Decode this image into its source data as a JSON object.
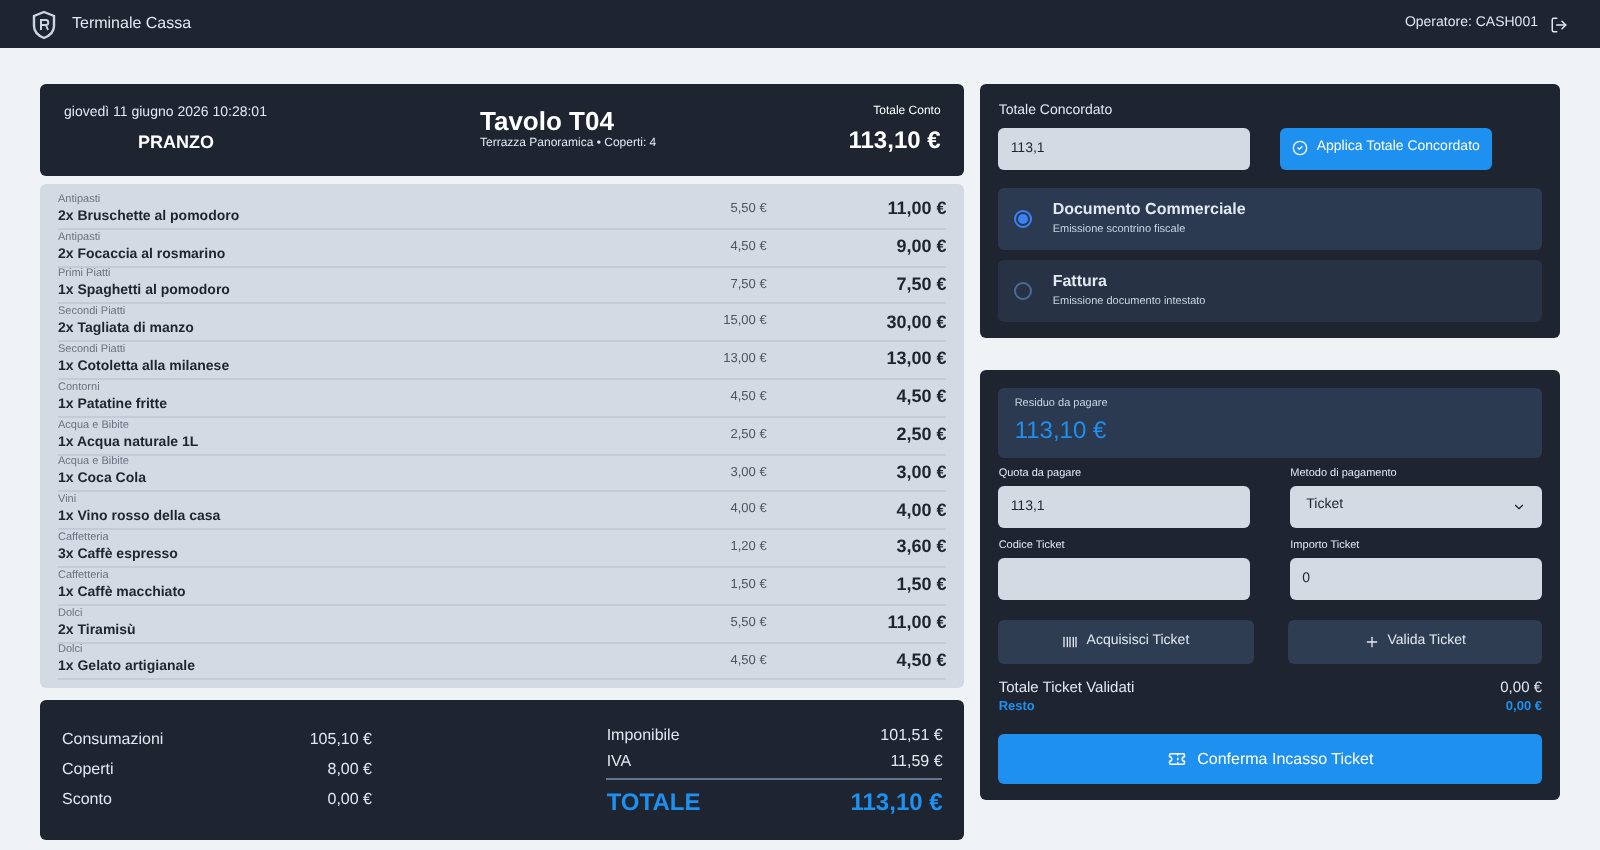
{
  "topbar": {
    "title": "Terminale Cassa",
    "operator": "Operatore: CASH001"
  },
  "order_header": {
    "datetime": "giovedì 11 giugno 2026 10:28:01",
    "service": "PRANZO",
    "table": "Tavolo T04",
    "location": "Terrazza Panoramica • Coperti: 4",
    "total_label": "Totale Conto",
    "total": "113,10 €"
  },
  "items": [
    {
      "category": "Antipasti",
      "name": "2x Bruschette al pomodoro",
      "unit_price": "5,50 €",
      "total": "11,00 €"
    },
    {
      "category": "Antipasti",
      "name": "2x Focaccia al rosmarino",
      "unit_price": "4,50 €",
      "total": "9,00 €"
    },
    {
      "category": "Primi Piatti",
      "name": "1x Spaghetti al pomodoro",
      "unit_price": "7,50 €",
      "total": "7,50 €"
    },
    {
      "category": "Secondi Piatti",
      "name": "2x Tagliata di manzo",
      "unit_price": "15,00 €",
      "total": "30,00 €"
    },
    {
      "category": "Secondi Piatti",
      "name": "1x Cotoletta alla milanese",
      "unit_price": "13,00 €",
      "total": "13,00 €"
    },
    {
      "category": "Contorni",
      "name": "1x Patatine fritte",
      "unit_price": "4,50 €",
      "total": "4,50 €"
    },
    {
      "category": "Acqua e Bibite",
      "name": "1x Acqua naturale 1L",
      "unit_price": "2,50 €",
      "total": "2,50 €"
    },
    {
      "category": "Acqua e Bibite",
      "name": "1x Coca Cola",
      "unit_price": "3,00 €",
      "total": "3,00 €"
    },
    {
      "category": "Vini",
      "name": "1x Vino rosso della casa",
      "unit_price": "4,00 €",
      "total": "4,00 €"
    },
    {
      "category": "Caffetteria",
      "name": "3x Caffè espresso",
      "unit_price": "1,20 €",
      "total": "3,60 €"
    },
    {
      "category": "Caffetteria",
      "name": "1x Caffè macchiato",
      "unit_price": "1,50 €",
      "total": "1,50 €"
    },
    {
      "category": "Dolci",
      "name": "2x Tiramisù",
      "unit_price": "5,50 €",
      "total": "11,00 €"
    },
    {
      "category": "Dolci",
      "name": "1x Gelato artigianale",
      "unit_price": "4,50 €",
      "total": "4,50 €"
    }
  ],
  "summary": {
    "left": [
      {
        "label": "Consumazioni",
        "value": "105,10 €"
      },
      {
        "label": "Coperti",
        "value": "8,00 €"
      },
      {
        "label": "Sconto",
        "value": "0,00 €"
      }
    ],
    "taxes": [
      {
        "label": "Imponibile",
        "value": "101,51 €"
      },
      {
        "label": "IVA",
        "value": "11,59 €"
      }
    ],
    "total_label": "TOTALE",
    "total": "113,10 €"
  },
  "agreed_total": {
    "label": "Totale Concordato",
    "value": "113,1",
    "button": "Applica Totale Concordato"
  },
  "documents": [
    {
      "title": "Documento Commerciale",
      "subtitle": "Emissione scontrino fiscale",
      "selected": true
    },
    {
      "title": "Fattura",
      "subtitle": "Emissione documento intestato",
      "selected": false
    }
  ],
  "payment": {
    "remaining_label": "Residuo da pagare",
    "remaining": "113,10 €",
    "fields": [
      {
        "label": "Quota da pagare",
        "value": "113,1",
        "kind": "input"
      },
      {
        "label": "Metodo di pagamento",
        "value": "Ticket",
        "kind": "select"
      },
      {
        "label": "Codice Ticket",
        "kind": "input"
      },
      {
        "label": "Importo Ticket",
        "value": "0",
        "kind": "input"
      }
    ],
    "buttons": [
      {
        "label": "Acquisisci Ticket",
        "kind": "barcode"
      },
      {
        "label": "Valida Ticket",
        "kind": "plus"
      }
    ],
    "validated_label": "Totale Ticket Validati",
    "validated_value": "0,00 €",
    "change_label": "Resto",
    "change_value": "0,00 €",
    "confirm_button": "Conferma Incasso Ticket"
  }
}
